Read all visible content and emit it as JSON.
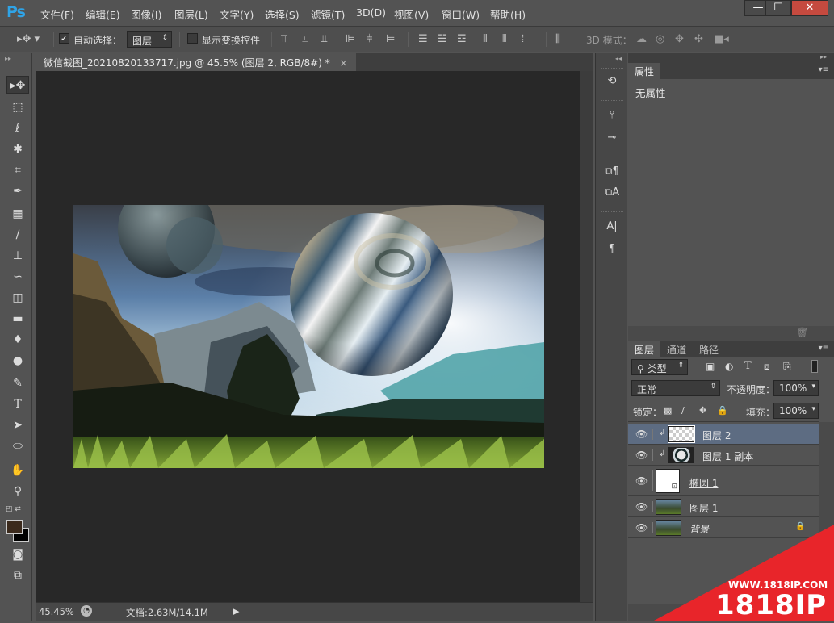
{
  "app": {
    "logo": "Ps"
  },
  "menu": [
    "文件(F)",
    "编辑(E)",
    "图像(I)",
    "图层(L)",
    "文字(Y)",
    "选择(S)",
    "滤镜(T)",
    "3D(D)",
    "视图(V)",
    "窗口(W)",
    "帮助(H)"
  ],
  "window_controls": {
    "minimize": "—",
    "maximize": "☐",
    "close": "✕"
  },
  "options": {
    "auto_select_label": "自动选择：",
    "auto_select_value": "图层",
    "show_transform_label": "显示变换控件",
    "mode_3d_label": "3D 模式："
  },
  "document": {
    "tab_title": "微信截图_20210820133717.jpg @ 45.5% (图层 2, RGB/8#) *",
    "tab_close": "×"
  },
  "status": {
    "zoom": "45.45%",
    "doc_info": "文档:2.63M/14.1M"
  },
  "properties": {
    "title": "属性",
    "content": "无属性"
  },
  "layers_panel": {
    "tabs": [
      "图层",
      "通道",
      "路径"
    ],
    "filter_kind": "类型",
    "blend_mode": "正常",
    "opacity_label": "不透明度：",
    "opacity_value": "100%",
    "lock_label": "锁定：",
    "fill_label": "填充：",
    "fill_value": "100%",
    "layers": [
      {
        "name": "图层 2",
        "selected": true,
        "clipped": true
      },
      {
        "name": "图层 1 副本",
        "selected": false,
        "clipped": true
      },
      {
        "name": "椭圆 1",
        "selected": false,
        "clipped": false
      },
      {
        "name": "图层 1",
        "selected": false,
        "clipped": false
      },
      {
        "name": "背景",
        "selected": false,
        "clipped": false,
        "locked": true
      }
    ]
  },
  "watermark": {
    "url": "WWW.1818IP.COM",
    "brand": "1818IP"
  },
  "colors": {
    "accent": "#2fa3e6",
    "watermark_red": "#e8252a",
    "selected_row": "#5d6c82"
  }
}
